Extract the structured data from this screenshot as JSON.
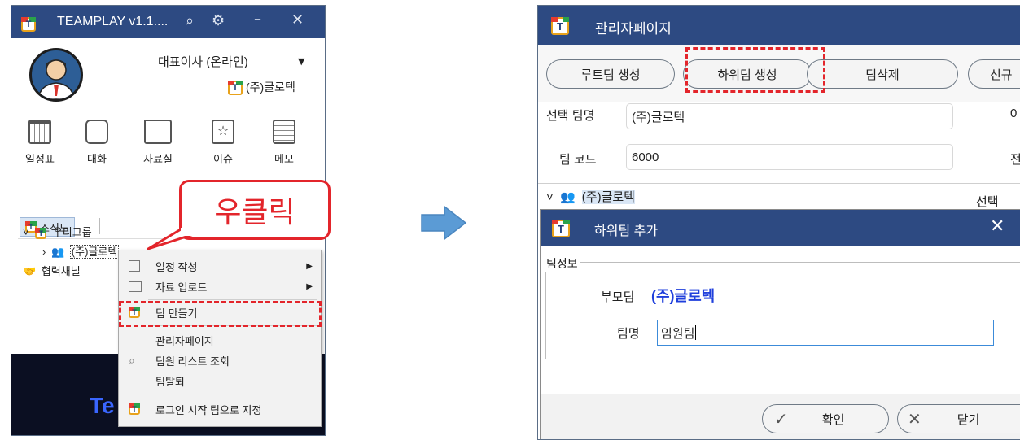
{
  "left_window": {
    "title": "TEAMPLAY v1.1....",
    "profile_name": "대표이사 (온라인)",
    "company": "(주)글로텍",
    "toolbar": [
      {
        "label": "일정표",
        "icon": "calendar-icon"
      },
      {
        "label": "대화",
        "icon": "chat-icon"
      },
      {
        "label": "자료실",
        "icon": "folder-icon"
      },
      {
        "label": "이슈",
        "icon": "star-doc-icon"
      },
      {
        "label": "메모",
        "icon": "memo-icon"
      }
    ],
    "org_tab": "조직도",
    "tree": {
      "group": "우리그룹",
      "company": "(주)글로텍",
      "partner": "협력채널"
    },
    "bottom_text": "Te",
    "callout": "우클릭",
    "context_menu": [
      {
        "label": "일정 작성",
        "icon": "calendar-icon",
        "submenu": true
      },
      {
        "label": "자료 업로드",
        "icon": "folder-icon",
        "submenu": true
      },
      {
        "label": "팀 만들기",
        "icon": "team-logo-icon",
        "submenu": false,
        "highlighted": true
      },
      {
        "label": "관리자페이지",
        "icon": "",
        "submenu": false
      },
      {
        "label": "팀원 리스트 조회",
        "icon": "search-icon",
        "submenu": false
      },
      {
        "label": "팀탈퇴",
        "icon": "",
        "submenu": false
      },
      {
        "label": "로그인 시작 팀으로 지정",
        "icon": "team-logo-icon",
        "submenu": false
      }
    ]
  },
  "admin_window": {
    "title": "관리자페이지",
    "buttons": {
      "root_team": "루트팀 생성",
      "sub_team": "하위팀 생성",
      "delete_team": "팀삭제",
      "new": "신규"
    },
    "selected_team_label": "선택 팀명",
    "selected_team_value": "(주)글로텍",
    "team_code_label": "팀 코드",
    "team_code_value": "6000",
    "right_col_1": "0",
    "right_col_2": "전",
    "tree_root": "(주)글로텍",
    "select_header": "선택"
  },
  "dialog": {
    "title": "하위팀 추가",
    "group_label": "팀정보",
    "parent_label": "부모팀",
    "parent_value": "(주)글로텍",
    "team_name_label": "팀명",
    "team_name_value": "임원팀",
    "confirm": "확인",
    "close": "닫기"
  },
  "colors": {
    "titlebar": "#2d4a82",
    "highlight": "#e3252b",
    "parent_team": "#1f3fdc"
  }
}
